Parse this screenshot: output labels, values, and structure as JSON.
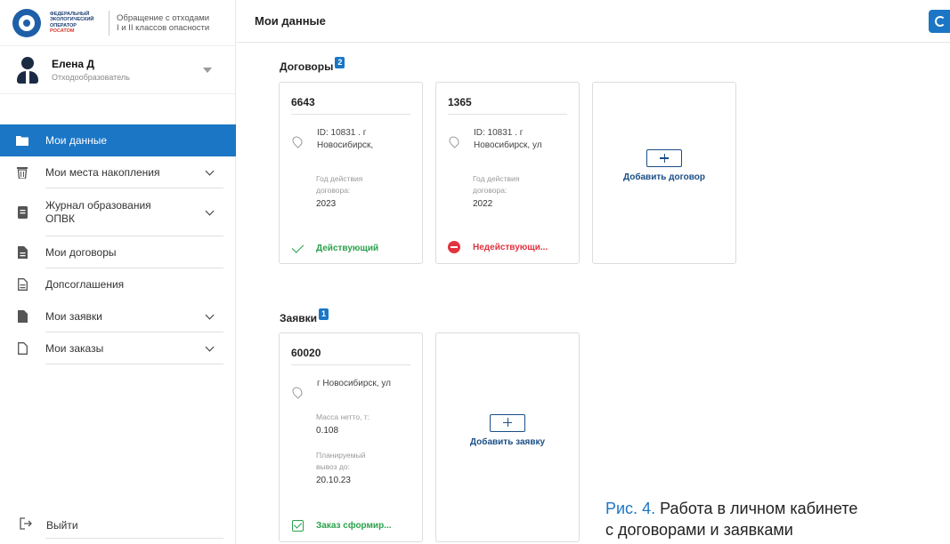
{
  "brand": {
    "org_lines": [
      "Федеральный",
      "экологический",
      "оператор",
      "Росатом"
    ],
    "desc_lines": [
      "Обращение с отходами",
      "I и II классов опасности"
    ]
  },
  "user": {
    "name": "Елена Д",
    "role": "Отходообразователь"
  },
  "nav": {
    "items": [
      {
        "label": "Мои данные"
      },
      {
        "label": "Мои места накопления"
      },
      {
        "label": "Журнал образования ОПВК"
      },
      {
        "label": "Мои договоры"
      },
      {
        "label": "Допсоглашения"
      },
      {
        "label": "Мои заявки"
      },
      {
        "label": "Мои заказы"
      }
    ],
    "logout": "Выйти"
  },
  "header": {
    "title": "Мои данные"
  },
  "contracts": {
    "title": "Договоры",
    "count": "2",
    "cards": [
      {
        "number": "6643",
        "address": "ID: 10831 . г Новосибирск,",
        "year_label": "Год действия договора:",
        "year": "2023",
        "status": "Действующий"
      },
      {
        "number": "1365",
        "address": "ID: 10831 . г Новосибирск, ул",
        "year_label": "Год действия договора:",
        "year": "2022",
        "status": "Недействующи..."
      }
    ],
    "add_label": "Добавить договор"
  },
  "requests": {
    "title": "Заявки",
    "count": "1",
    "cards": [
      {
        "number": "60020",
        "address": "г Новосибирск, ул",
        "mass_label": "Масса нетто, т:",
        "mass": "0.108",
        "date_label": "Планируемый вывоз до:",
        "date": "20.10.23",
        "status": "Заказ сформир..."
      }
    ],
    "add_label": "Добавить заявку"
  },
  "caption": {
    "number": "Рис. 4.",
    "line1": "Работа в личном кабинете",
    "line2": "с договорами и заявками"
  },
  "colors": {
    "accent": "#1b76c5",
    "ok": "#2aa14b",
    "bad": "#e2333f",
    "add": "#1b4e86"
  }
}
